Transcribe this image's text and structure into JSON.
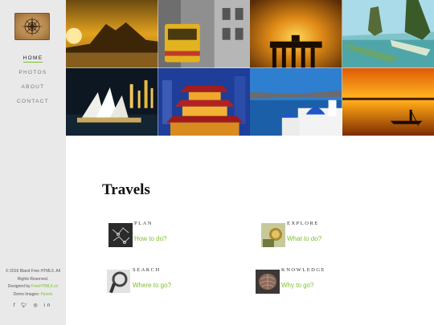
{
  "sidebar": {
    "nav": [
      {
        "label": "HOME",
        "active": true
      },
      {
        "label": "PHOTOS",
        "active": false
      },
      {
        "label": "ABOUT",
        "active": false
      },
      {
        "label": "CONTACT",
        "active": false
      }
    ],
    "footer": {
      "line1": "© 2016 Bland Free HTML5. All",
      "line2": "Rights Reserved.",
      "designed_prefix": "Designed by ",
      "designed_link": "FreeHTML5.co",
      "demo_prefix": "Demo Images: ",
      "demo_link": "Pexels"
    },
    "social_icons": [
      "facebook-icon",
      "twitter-icon",
      "instagram-icon",
      "linkedin-icon"
    ]
  },
  "main": {
    "title": "Travels",
    "features": [
      {
        "heading": "PLAN",
        "link": "How to do?"
      },
      {
        "heading": "EXPLORE",
        "link": "What to do?"
      },
      {
        "heading": "SEARCH",
        "link": "Where to go?"
      },
      {
        "heading": "KNOWLEDGE",
        "link": "Why to go?"
      }
    ]
  },
  "colors": {
    "accent": "#7bbf2a",
    "sidebar_bg": "#e9e9e9"
  }
}
